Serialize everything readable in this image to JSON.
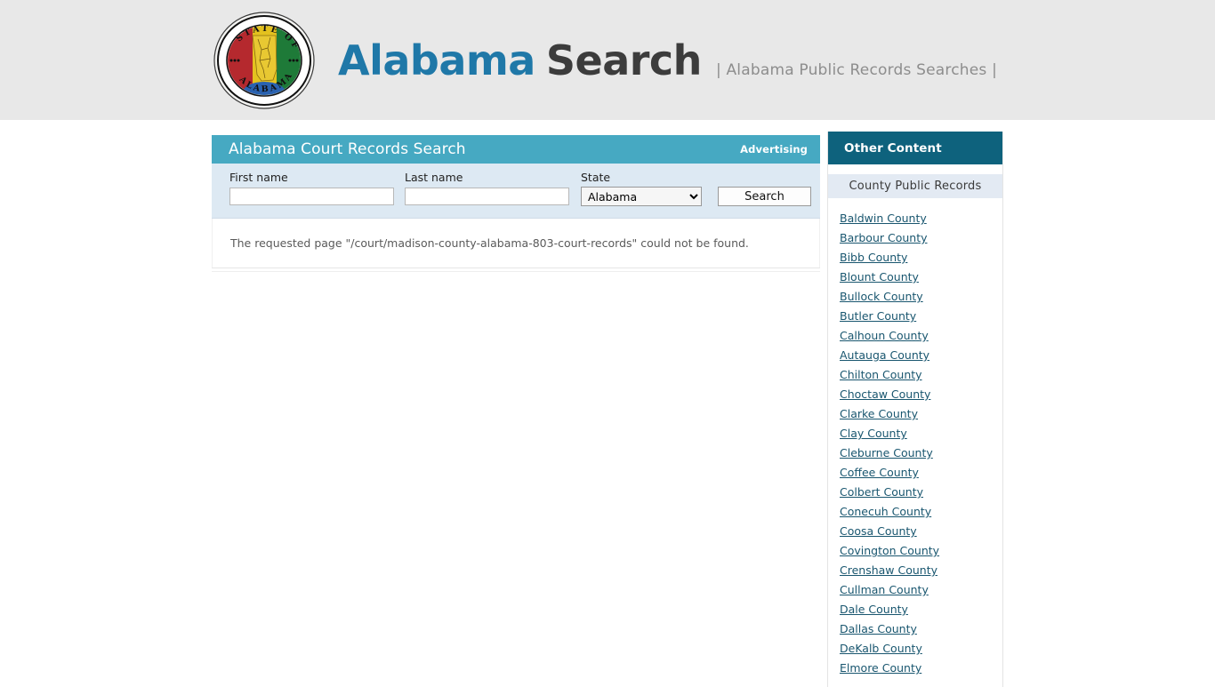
{
  "banner": {
    "seal": {
      "icon": "alabama-state-seal",
      "top_text": "STATE OF",
      "bottom_text": "ALABAMA"
    },
    "title_primary": "Alabama",
    "title_secondary": "Search",
    "tagline": "| Alabama Public Records Searches |"
  },
  "main_panel": {
    "header_title": "Alabama Court Records Search",
    "advertising_label": "Advertising",
    "form": {
      "first_name_label": "First name",
      "first_name_value": "",
      "first_name_placeholder": "",
      "last_name_label": "Last name",
      "last_name_value": "",
      "last_name_placeholder": "",
      "state_label": "State",
      "state_selected": "Alabama",
      "state_options": [
        "Alabama"
      ],
      "search_button": "Search"
    },
    "error_message": "The requested page \"/court/madison-county-alabama-803-court-records\" could not be found."
  },
  "sidebar": {
    "header_title": "Other Content",
    "section_title": "County Public Records",
    "counties": [
      "Baldwin County",
      "Barbour County",
      "Bibb County",
      "Blount County",
      "Bullock County",
      "Butler County",
      "Calhoun County",
      "Autauga County",
      "Chilton County",
      "Choctaw County",
      "Clarke County",
      "Clay County",
      "Cleburne County",
      "Coffee County",
      "Colbert County",
      "Conecuh County",
      "Coosa County",
      "Covington County",
      "Crenshaw County",
      "Cullman County",
      "Dale County",
      "Dallas County",
      "DeKalb County",
      "Elmore County"
    ]
  },
  "colors": {
    "banner_bg": "#e8e8e8",
    "panel_header": "#46a9c2",
    "sidebar_header": "#0e627d",
    "form_bg": "#dde9f3",
    "section_header_bg": "#e3eaf3",
    "title_primary": "#1f78a8",
    "title_secondary": "#3c3c3c",
    "link": "#19566f"
  }
}
